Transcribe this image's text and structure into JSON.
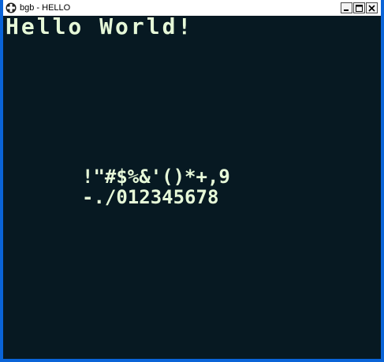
{
  "window": {
    "title": "bgb - HELLO",
    "icon": "dpad-icon",
    "controls": [
      "minimize",
      "maximize",
      "close"
    ]
  },
  "screen": {
    "background": "#071922",
    "foreground": "#e6f8d8",
    "lines": {
      "heading": "Hello World!",
      "row1": "!\"#$%&'()*+,9",
      "row2": "-./012345678"
    }
  },
  "colors": {
    "frame": "#0a64d8",
    "titlebar": "#ffffff"
  }
}
